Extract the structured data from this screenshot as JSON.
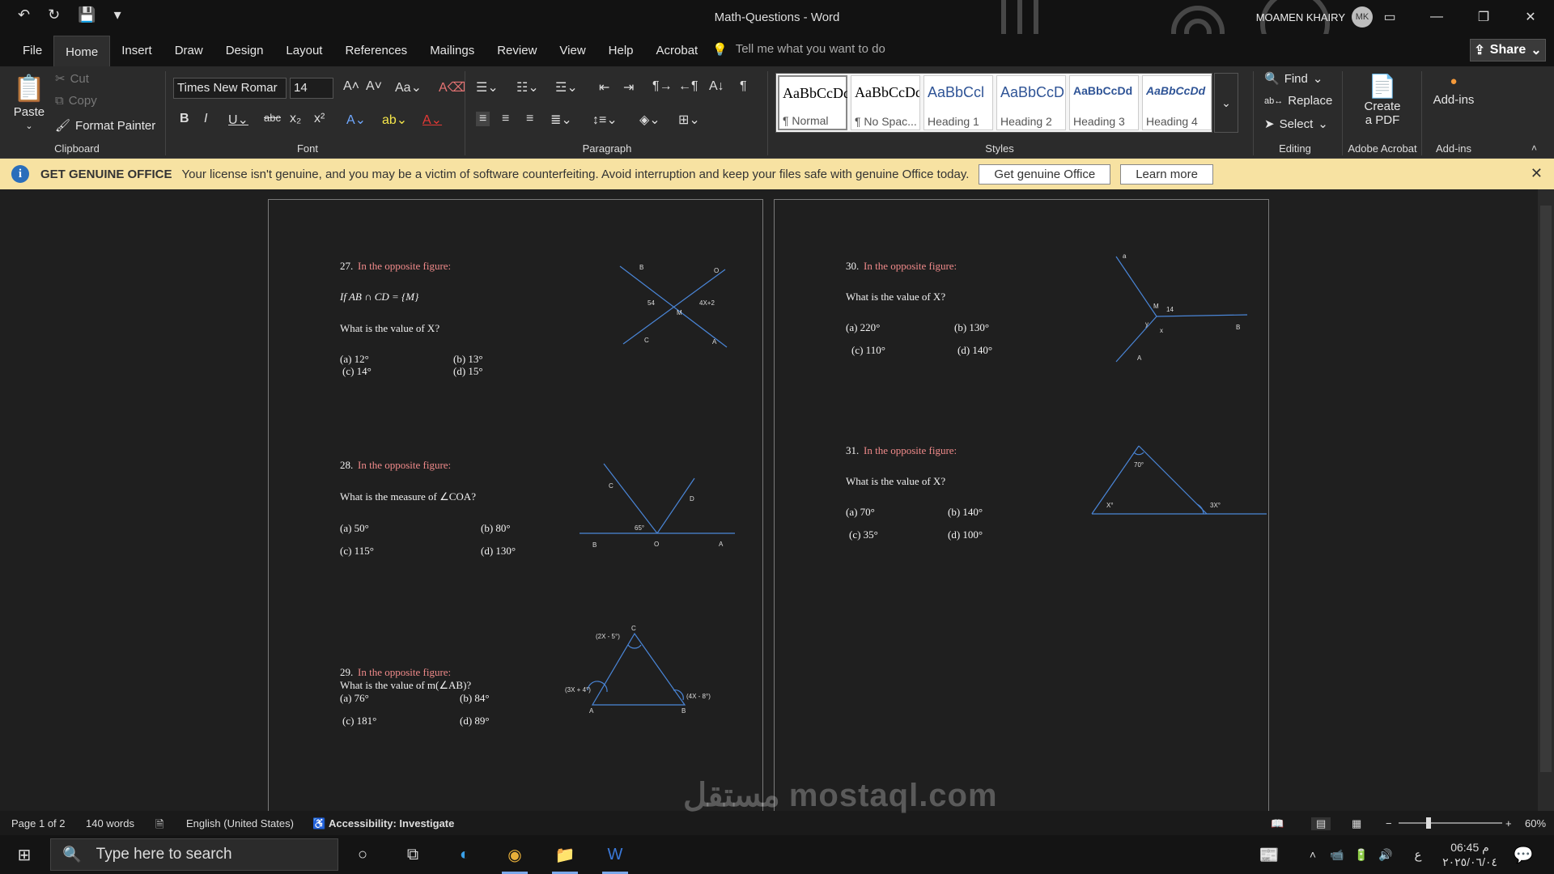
{
  "window": {
    "title": "Math-Questions  -  Word",
    "user": "MOAMEN KHAIRY",
    "avatar": "MK"
  },
  "qat": {
    "undo": "↶",
    "redo": "↻",
    "save": "💾",
    "more": "▾"
  },
  "menu": {
    "items": [
      "File",
      "Home",
      "Insert",
      "Draw",
      "Design",
      "Layout",
      "References",
      "Mailings",
      "Review",
      "View",
      "Help",
      "Acrobat"
    ],
    "tell": "Tell me what you want to do",
    "share": "Share"
  },
  "ribbon": {
    "clipboard": {
      "paste": "Paste",
      "cut": "Cut",
      "copy": "Copy",
      "painter": "Format Painter",
      "label": "Clipboard"
    },
    "font": {
      "name": "Times New Romar",
      "size": "14",
      "label": "Font"
    },
    "paragraph": {
      "label": "Paragraph"
    },
    "styles": {
      "label": "Styles",
      "items": [
        {
          "preview": "AaBbCcDd",
          "name": "¶ Normal"
        },
        {
          "preview": "AaBbCcDd",
          "name": "¶ No Spac..."
        },
        {
          "preview": "AaBbCcl",
          "name": "Heading 1"
        },
        {
          "preview": "AaBbCcD",
          "name": "Heading 2"
        },
        {
          "preview": "AaBbCcDd",
          "name": "Heading 3"
        },
        {
          "preview": "AaBbCcDd",
          "name": "Heading 4"
        }
      ]
    },
    "editing": {
      "find": "Find",
      "replace": "Replace",
      "select": "Select",
      "label": "Editing"
    },
    "acrobat": {
      "create": "Create",
      "pdf": "a PDF",
      "label": "Adobe Acrobat"
    },
    "addins": {
      "btn": "Add-ins",
      "label": "Add-ins"
    }
  },
  "license": {
    "title": "GET GENUINE OFFICE",
    "message": "Your license isn't genuine, and you may be a victim of software counterfeiting. Avoid interruption and keep your files safe with genuine Office today.",
    "btn1": "Get genuine Office",
    "btn2": "Learn more"
  },
  "doc": {
    "q27": {
      "num": "27.",
      "title": "In the opposite figure:",
      "line1": "If AB ∩ CD = {M}",
      "line2": "What is the value of X?",
      "a": "(a) 12°",
      "b": "(b) 13°",
      "c": "(c) 14°",
      "d": "(d) 15°",
      "labels": {
        "B": "B",
        "O": "O",
        "C": "C",
        "A": "A",
        "M": "M",
        "s4": "54",
        "expr": "4X+2"
      }
    },
    "q28": {
      "num": "28.",
      "title": "In the opposite figure:",
      "line1": "What is the measure of ∠COA?",
      "a": "(a) 50°",
      "b": "(b) 80°",
      "c": "(c) 115°",
      "d": "(d) 130°",
      "labels": {
        "C": "C",
        "D": "D",
        "B": "B",
        "O": "O",
        "A": "A",
        "ang": "65°"
      }
    },
    "q29": {
      "num": "29.",
      "title": "In the opposite figure:",
      "line1": "What is the value of m(∠AB)?",
      "a": "(a) 76°",
      "b": "(b) 84°",
      "c": "(c) 181°",
      "d": "(d) 89°",
      "labels": {
        "C": "C",
        "A": "A",
        "B": "B",
        "top": "(2X - 5°)",
        "left": "(3X + 4°)",
        "right": "(4X - 8°)"
      }
    },
    "q30": {
      "num": "30.",
      "title": "In the opposite figure:",
      "line1": "What is the value of X?",
      "a": "(a) 220°",
      "b": "(b) 130°",
      "c": "(c) 110°",
      "d": "(d) 140°",
      "labels": {
        "top": "a",
        "M": "M",
        "n14": "14",
        "y": "y",
        "x": "x",
        "B": "B",
        "A": "A"
      }
    },
    "q31": {
      "num": "31.",
      "title": "In the opposite figure:",
      "line1": "What is the value of X?",
      "a": "(a) 70°",
      "b": "(b) 140°",
      "c": "(c) 35°",
      "d": "(d) 100°",
      "labels": {
        "top": "70°",
        "left": "X°",
        "right": "3X°"
      }
    }
  },
  "status": {
    "page": "Page 1 of 2",
    "words": "140 words",
    "lang": "English (United States)",
    "access": "Accessibility: Investigate",
    "zoom": "60%"
  },
  "taskbar": {
    "search": "Type here to search",
    "time": "06:45 م",
    "date": "٢٠٢٥/٠٦/٠٤",
    "lang": "ع"
  },
  "watermark": "مستقل mostaql.com"
}
